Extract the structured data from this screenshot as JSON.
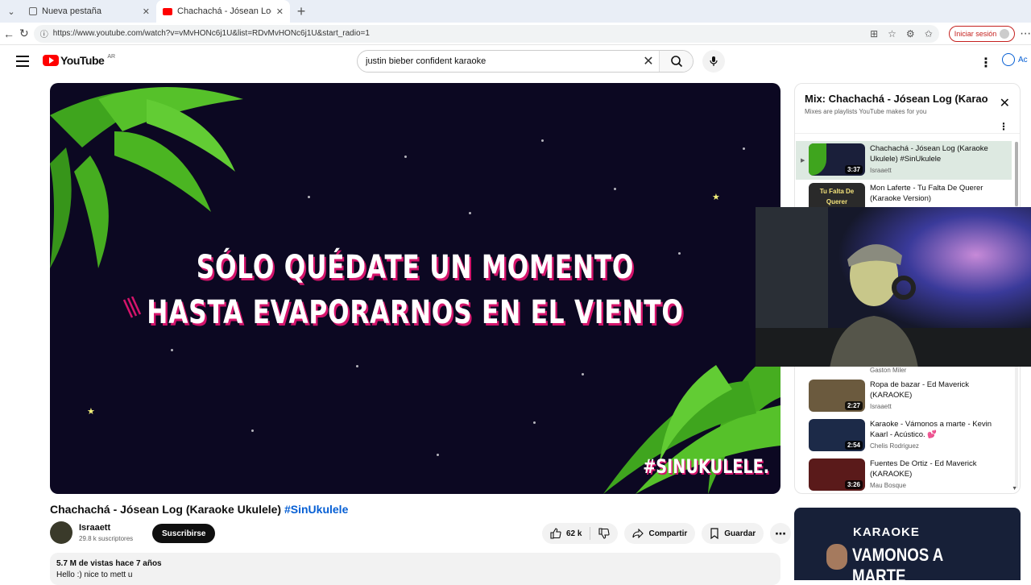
{
  "browser": {
    "tabs": [
      {
        "title": "Nueva pestaña",
        "active": false
      },
      {
        "title": "Chachachá - Jósean Log (Karaoke",
        "active": true
      }
    ],
    "url": "https://www.youtube.com/watch?v=vMvHONc6j1U&list=RDvMvHONc6j1U&start_radio=1",
    "signin_label": "Iniciar sesión"
  },
  "youtube": {
    "logo_text": "YouTube",
    "country": "AR",
    "search_value": "justin bieber confident karaoke",
    "account_label": "Ac"
  },
  "video": {
    "lyric_line1": "SÓLO QUÉDATE UN MOMENTO",
    "lyric_line2": "HASTA EVAPORARNOS EN EL VIENTO",
    "watermark": "#SINUKULELE.",
    "title": "Chachachá - Jósean Log (Karaoke Ukulele)",
    "title_hashtag": "#SinUkulele",
    "channel_name": "Israaett",
    "channel_subs": "29.8 k suscriptores",
    "subscribe_label": "Suscribirse",
    "likes": "62 k",
    "share_label": "Compartir",
    "save_label": "Guardar",
    "description_meta": "5.7 M de vistas  hace 7 años",
    "description_text": "Hello :) nice to mett u"
  },
  "playlist": {
    "title": "Mix: Chachachá - Jósean Log (Karaoke Ukulele)",
    "subtitle": "Mixes are playlists YouTube makes for you",
    "items": [
      {
        "title": "Chachachá - Jósean Log (Karaoke Ukulele) #SinUkulele",
        "channel": "Israaett",
        "duration": "3:37",
        "active": true,
        "thumb_color": "#1a1f3a"
      },
      {
        "title": "Mon Laferte - Tu Falta De Querer (Karaoke Version)",
        "channel": "",
        "duration": "",
        "active": false,
        "thumb_color": "#2a2a2a",
        "thumb_text": "Tu Falta De Querer"
      },
      {
        "title": "",
        "channel": "Gaston Miler",
        "duration": "",
        "active": false,
        "thumb_color": "#444"
      },
      {
        "title": "Ropa de bazar - Ed Maverick (KARAOKE)",
        "channel": "Israaett",
        "duration": "2:27",
        "active": false,
        "thumb_color": "#6b5a3e"
      },
      {
        "title": "Karaoke - Vámonos a marte - Kevin Kaarl - Acústico. 💕",
        "channel": "Chelis Rodriguez",
        "duration": "2:54",
        "active": false,
        "thumb_color": "#1c2a48"
      },
      {
        "title": "Fuentes De Ortiz - Ed Maverick (KARAOKE)",
        "channel": "Mau Bosque",
        "duration": "3:26",
        "active": false,
        "thumb_color": "#5a1a1a"
      }
    ]
  },
  "promo": {
    "line1": "KARAOKE",
    "line2": "VAMONOS A MARTE"
  },
  "colors": {
    "accent": "#ff0000",
    "link": "#065fd4",
    "lyric_shadow": "#d4146b"
  }
}
